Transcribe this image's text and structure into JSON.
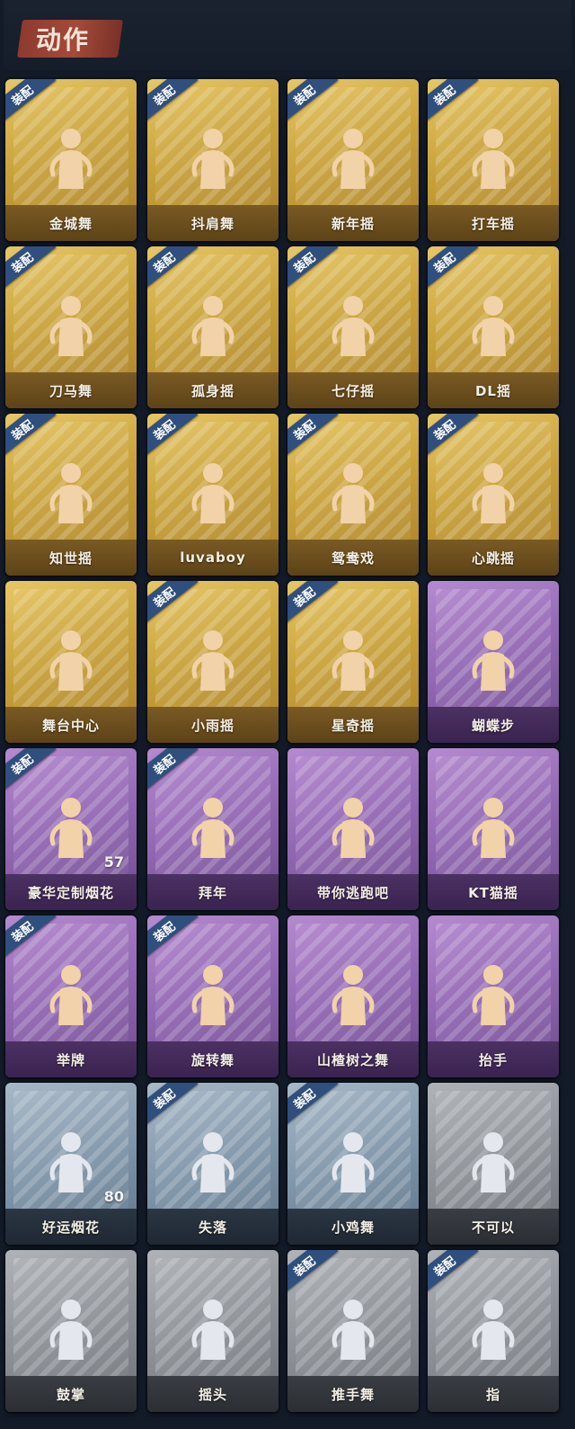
{
  "header": {
    "title": "动作"
  },
  "badge_label": "装配",
  "items": [
    {
      "label": "金城舞",
      "tier": "gold",
      "equipped": true,
      "count": ""
    },
    {
      "label": "抖肩舞",
      "tier": "gold",
      "equipped": true,
      "count": ""
    },
    {
      "label": "新年摇",
      "tier": "gold",
      "equipped": true,
      "count": ""
    },
    {
      "label": "打车摇",
      "tier": "gold",
      "equipped": true,
      "count": ""
    },
    {
      "label": "刀马舞",
      "tier": "gold",
      "equipped": true,
      "count": ""
    },
    {
      "label": "孤身摇",
      "tier": "gold",
      "equipped": true,
      "count": ""
    },
    {
      "label": "七仔摇",
      "tier": "gold",
      "equipped": true,
      "count": ""
    },
    {
      "label": "DL摇",
      "tier": "gold",
      "equipped": true,
      "count": ""
    },
    {
      "label": "知世摇",
      "tier": "gold",
      "equipped": true,
      "count": ""
    },
    {
      "label": "luvaboy",
      "tier": "gold",
      "equipped": true,
      "count": ""
    },
    {
      "label": "鸳鸯戏",
      "tier": "gold",
      "equipped": true,
      "count": ""
    },
    {
      "label": "心跳摇",
      "tier": "gold",
      "equipped": true,
      "count": ""
    },
    {
      "label": "舞台中心",
      "tier": "gold",
      "equipped": false,
      "count": ""
    },
    {
      "label": "小雨摇",
      "tier": "gold",
      "equipped": true,
      "count": ""
    },
    {
      "label": "星奇摇",
      "tier": "gold",
      "equipped": true,
      "count": ""
    },
    {
      "label": "蝴蝶步",
      "tier": "purple",
      "equipped": false,
      "count": ""
    },
    {
      "label": "豪华定制烟花",
      "tier": "purple",
      "equipped": true,
      "count": "57"
    },
    {
      "label": "拜年",
      "tier": "purple",
      "equipped": true,
      "count": ""
    },
    {
      "label": "带你逃跑吧",
      "tier": "purple",
      "equipped": false,
      "count": ""
    },
    {
      "label": "KT猫摇",
      "tier": "purple",
      "equipped": false,
      "count": ""
    },
    {
      "label": "举牌",
      "tier": "purple",
      "equipped": true,
      "count": ""
    },
    {
      "label": "旋转舞",
      "tier": "purple",
      "equipped": true,
      "count": ""
    },
    {
      "label": "山楂树之舞",
      "tier": "purple",
      "equipped": false,
      "count": ""
    },
    {
      "label": "抬手",
      "tier": "purple",
      "equipped": false,
      "count": ""
    },
    {
      "label": "好运烟花",
      "tier": "blue",
      "equipped": false,
      "count": "80"
    },
    {
      "label": "失落",
      "tier": "blue",
      "equipped": true,
      "count": ""
    },
    {
      "label": "小鸡舞",
      "tier": "blue",
      "equipped": true,
      "count": ""
    },
    {
      "label": "不可以",
      "tier": "gray",
      "equipped": false,
      "count": ""
    },
    {
      "label": "鼓掌",
      "tier": "gray",
      "equipped": false,
      "count": ""
    },
    {
      "label": "摇头",
      "tier": "gray",
      "equipped": false,
      "count": ""
    },
    {
      "label": "推手舞",
      "tier": "gray",
      "equipped": true,
      "count": ""
    },
    {
      "label": "指",
      "tier": "gray",
      "equipped": true,
      "count": ""
    }
  ]
}
